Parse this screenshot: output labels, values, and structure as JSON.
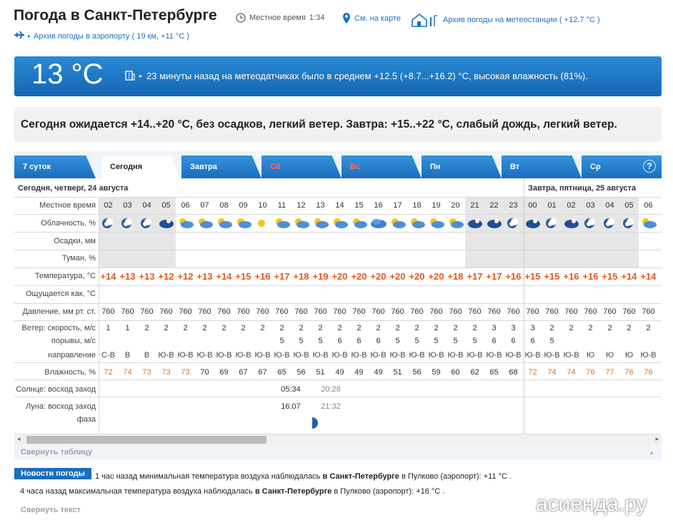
{
  "header": {
    "title": "Погода в Санкт-Петербурге",
    "local_time_label": "Местное время",
    "local_time": "1:34",
    "map_link": "См. на карте",
    "station_archive": "Архив погоды на метеостанции ( +12.7 °C )",
    "airport_archive": "Архив погоды в аэропорту ( 19 км, +11 °C )"
  },
  "current": {
    "temperature": "13 °C",
    "message": "23 минуты назад на метеодатчиках было в среднем +12.5 (+8.7...+16.2) °C, высокая влажность (81%)."
  },
  "forecast_text": "Сегодня ожидается +14..+20 °C, без осадков, легкий ветер. Завтра: +15..+22 °C, слабый дождь, легкий ветер.",
  "tabs": [
    {
      "label": "7 суток"
    },
    {
      "label": "Сегодня"
    },
    {
      "label": "Завтра"
    },
    {
      "label": "Сб"
    },
    {
      "label": "Вс"
    },
    {
      "label": "Пн"
    },
    {
      "label": "Вт"
    },
    {
      "label": "Ср"
    }
  ],
  "help_label": "?",
  "table": {
    "day1_label": "Сегодня, четверг, 24 августа",
    "day2_label": "Завтра, пятница, 25 августа",
    "rows": {
      "time": "Местное время",
      "cloud": "Облачность, %",
      "precip": "Осадки, мм",
      "fog": "Туман, %",
      "temp": "Температура, °C",
      "feels": "Ощущается как, °C",
      "pressure": "Давление, мм рт. ст.",
      "wind": "Ветер: скорость, м/с",
      "gusts": "порывы, м/с",
      "direction": "направление",
      "humidity": "Влажность, %",
      "sun": "Солнце: восход заход",
      "moon": "Луна: восход заход",
      "phase": "фаза"
    },
    "hours": [
      "02",
      "03",
      "04",
      "05",
      "06",
      "07",
      "08",
      "09",
      "10",
      "11",
      "12",
      "13",
      "14",
      "15",
      "16",
      "17",
      "18",
      "19",
      "20",
      "21",
      "22",
      "23",
      "00",
      "01",
      "02",
      "03",
      "04",
      "05",
      "06"
    ],
    "cloud_icons": [
      "night-partly-cloudy-icon",
      "night-partly-cloudy-icon",
      "night-partly-cloudy-icon",
      "night-cloudy-icon",
      "day-partly-cloudy-icon",
      "day-partly-cloudy-icon",
      "day-partly-cloudy-icon",
      "day-partly-cloudy-icon",
      "sun-icon",
      "day-partly-cloudy-icon",
      "day-partly-cloudy-icon",
      "day-partly-cloudy-icon",
      "day-partly-cloudy-icon",
      "day-partly-cloudy-icon",
      "day-cloudy-icon",
      "day-partly-cloudy-icon",
      "day-partly-cloudy-icon",
      "day-partly-cloudy-icon",
      "day-partly-cloudy-icon",
      "night-cloudy-icon",
      "night-cloudy-icon",
      "night-partly-cloudy-icon",
      "night-cloudy-icon",
      "night-partly-cloudy-icon",
      "night-cloudy-icon",
      "night-partly-cloudy-icon",
      "night-partly-cloudy-icon",
      "night-partly-cloudy-icon",
      "day-partly-cloudy-icon"
    ],
    "temps": [
      "+14",
      "+13",
      "+13",
      "+12",
      "+12",
      "+13",
      "+14",
      "+15",
      "+16",
      "+17",
      "+18",
      "+19",
      "+20",
      "+20",
      "+20",
      "+20",
      "+20",
      "+20",
      "+18",
      "+17",
      "+17",
      "+16",
      "+15",
      "+15",
      "+16",
      "+16",
      "+15",
      "+14",
      "+14"
    ],
    "pressure": [
      "760",
      "760",
      "760",
      "760",
      "760",
      "760",
      "760",
      "760",
      "760",
      "760",
      "760",
      "760",
      "760",
      "760",
      "760",
      "760",
      "760",
      "760",
      "760",
      "760",
      "760",
      "760",
      "760",
      "760",
      "760",
      "760",
      "760",
      "760",
      "760"
    ],
    "wind": [
      "1",
      "1",
      "2",
      "2",
      "2",
      "2",
      "2",
      "2",
      "2",
      "2",
      "2",
      "2",
      "2",
      "2",
      "2",
      "2",
      "2",
      "2",
      "2",
      "2",
      "3",
      "3",
      "3",
      "2",
      "2",
      "2",
      "2",
      "2",
      "2"
    ],
    "gusts": [
      "",
      "",
      "",
      "",
      "",
      "",
      "",
      "",
      "",
      "5",
      "5",
      "5",
      "6",
      "6",
      "6",
      "5",
      "5",
      "5",
      "5",
      "5",
      "6",
      "6",
      "6",
      "5",
      "",
      "",
      "",
      "",
      ""
    ],
    "direction": [
      "С-В",
      "В",
      "В",
      "Ю-В",
      "Ю-В",
      "Ю-В",
      "Ю-В",
      "Ю-В",
      "Ю-В",
      "Ю-В",
      "Ю-В",
      "Ю-В",
      "Ю-В",
      "Ю-В",
      "Ю-В",
      "Ю-В",
      "Ю-В",
      "Ю-В",
      "Ю-В",
      "Ю-В",
      "Ю-В",
      "Ю-В",
      "Ю-В",
      "Ю-В",
      "Ю-В",
      "Ю",
      "Ю",
      "Ю",
      "Ю-В"
    ],
    "humidity": [
      "72",
      "74",
      "73",
      "73",
      "73",
      "70",
      "69",
      "67",
      "67",
      "65",
      "56",
      "51",
      "49",
      "49",
      "49",
      "51",
      "56",
      "59",
      "60",
      "62",
      "65",
      "68",
      "72",
      "74",
      "74",
      "76",
      "77",
      "76",
      "76"
    ],
    "sunrise": "05:34",
    "sunset": "20:28",
    "moonrise": "16:07",
    "moonset": "21:32"
  },
  "collapse_table": "Свернуть таблицу",
  "news": {
    "button": "Новости погоды",
    "line1_prefix": "1 час назад минимальная температура воздуха наблюдалась",
    "line1_bold": "в Санкт-Петербурге",
    "line1_suffix": "в Пулково (аэропорт): +11 °C .",
    "line2_prefix": "4 часа назад максимальная температура воздуха наблюдалась",
    "line2_bold": "в Санкт-Петербурге",
    "line2_suffix": "в Пулково (аэропорт): +16 °C .",
    "collapse": "Свернуть текст"
  },
  "watermark": "асиенда.ру",
  "colors": {
    "accent": "#1a6dbd",
    "temp": "#e8561e",
    "humidity_high": "#e8701e"
  }
}
